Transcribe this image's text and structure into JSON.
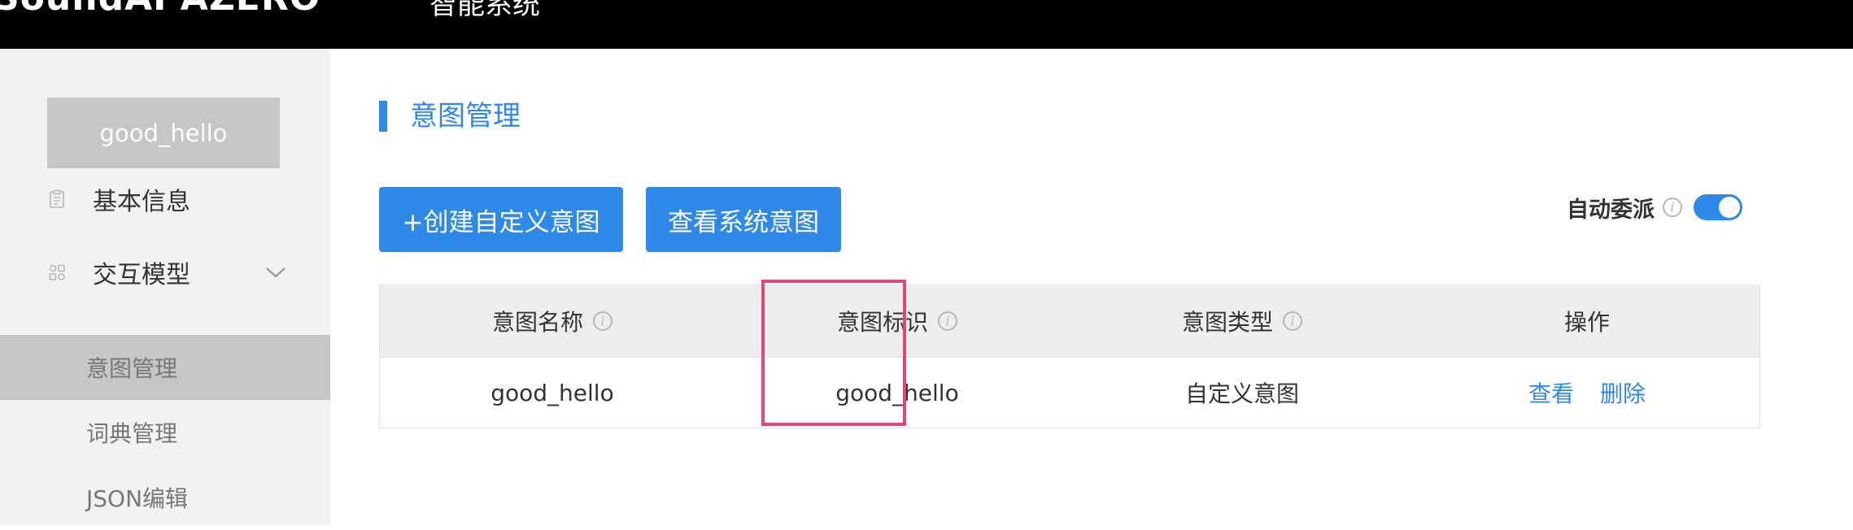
{
  "header": {
    "brand": "SoundAI AZERO",
    "product": "智能系统"
  },
  "sidebar": {
    "bot_name": "good_hello",
    "items": [
      {
        "label": "基本信息",
        "icon": "document-icon"
      },
      {
        "label": "交互模型",
        "icon": "model-icon",
        "expanded": true
      }
    ],
    "sub_items": [
      {
        "label": "意图管理",
        "active": true
      },
      {
        "label": "词典管理",
        "active": false
      },
      {
        "label": "JSON编辑",
        "active": false
      }
    ]
  },
  "main": {
    "title": "意图管理",
    "buttons": {
      "create": "+创建自定义意图",
      "system": "查看系统意图"
    },
    "auto_delegate": {
      "label": "自动委派",
      "enabled": true
    },
    "table": {
      "headers": [
        "意图名称",
        "意图标识",
        "意图类型",
        "操作"
      ],
      "rows": [
        {
          "name": "good_hello",
          "identifier": "good_hello",
          "type": "自定义意图",
          "actions": [
            "查看",
            "删除"
          ]
        }
      ]
    }
  },
  "colors": {
    "accent": "#2f89e8",
    "highlight": "#e4457c",
    "sidebar_bg": "#f2f2f2",
    "sidebar_active": "#c6c6c6"
  }
}
